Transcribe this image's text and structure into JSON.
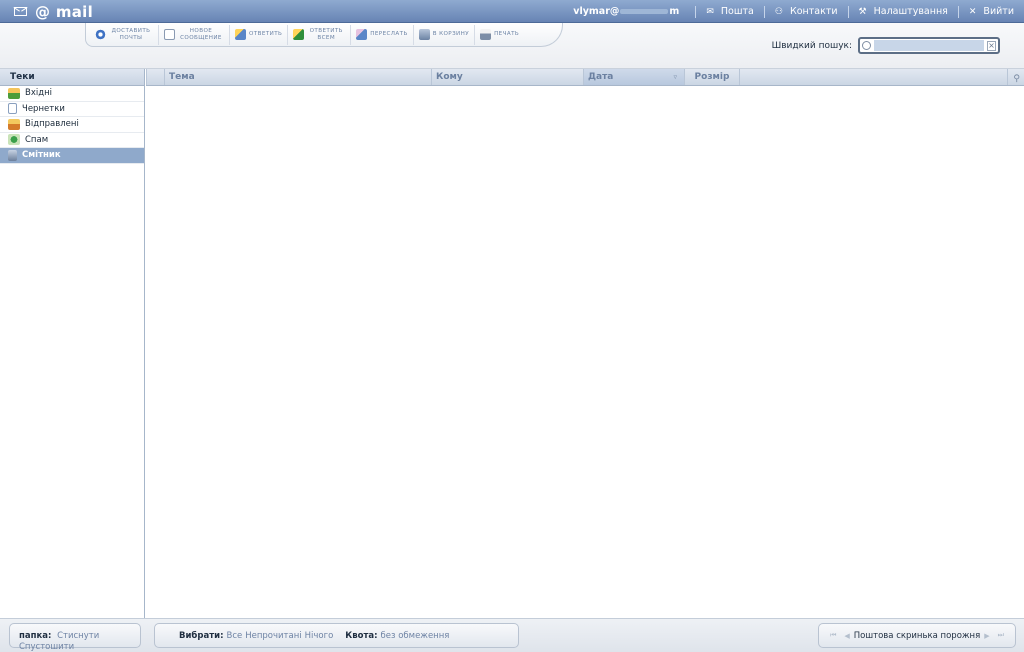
{
  "app": {
    "brand": "@ mail"
  },
  "topnav": {
    "user_prefix": "vlymar@",
    "user_suffix": "m",
    "mail_label": "Пошта",
    "contacts_label": "Контакти",
    "settings_label": "Налаштування",
    "logout_label": "Вийти"
  },
  "toolbar": {
    "get_mail_label": "доставить почты",
    "new_message_label": "новое сообщение",
    "reply_label": "ответить",
    "reply_all_label": "ответить всем",
    "forward_label": "переслать",
    "trash_label": "в корзину",
    "print_label": "печать"
  },
  "search": {
    "label": "Швидкий пошук:",
    "value": "",
    "clear": "×"
  },
  "folders": {
    "header": "Теки",
    "items": [
      {
        "label": "Вхідні",
        "icon": "inbox-icon"
      },
      {
        "label": "Чернетки",
        "icon": "drafts-icon"
      },
      {
        "label": "Відправлені",
        "icon": "sent-icon"
      },
      {
        "label": "Спам",
        "icon": "spam-icon"
      },
      {
        "label": "Смітник",
        "icon": "trash-icon"
      }
    ],
    "selected": "Смітник"
  },
  "list": {
    "columns": {
      "subject": "Тема",
      "to": "Кому",
      "date": "Дата",
      "size": "Розмір"
    },
    "sort_indicator": "▿",
    "rows": []
  },
  "footer": {
    "folder_key": "папка:",
    "collapse": "Стиснути",
    "empty_folder": "Спустошити",
    "select_key": "Вибрати:",
    "select_all": "Все",
    "select_unread": "Непрочитані",
    "select_none": "Нічого",
    "quota_key": "Квота:",
    "quota_value": "без обмеження",
    "status": "Поштова скринька порожня"
  },
  "colors": {
    "topbar": "#6f8bba",
    "accent_link": "#6e83a4",
    "selected_folder": "#8fa9cb"
  }
}
